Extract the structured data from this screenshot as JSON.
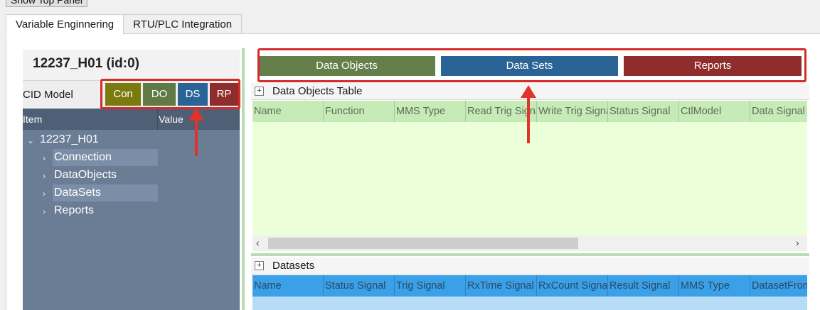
{
  "top_panel_button": "Show Top Panel",
  "tabs": [
    {
      "label": "Variable Enginnering",
      "active": true
    },
    {
      "label": "RTU/PLC Integration",
      "active": false
    }
  ],
  "left_panel": {
    "title": "12237_H01 (id:0)",
    "cid_label": "CID Model",
    "model_buttons": [
      {
        "label": "Con",
        "color": "#7a7a0e"
      },
      {
        "label": "DO",
        "color": "#5f7a45"
      },
      {
        "label": "DS",
        "color": "#2a6496"
      },
      {
        "label": "RP",
        "color": "#8f2d2d"
      }
    ],
    "tree_headers": {
      "item": "Item",
      "value": "Value"
    },
    "tree": {
      "root": "12237_H01",
      "children": [
        "Connection",
        "DataObjects",
        "DataSets",
        "Reports"
      ]
    }
  },
  "main_buttons": [
    {
      "label": "Data Objects",
      "color": "#647f4a"
    },
    {
      "label": "Data Sets",
      "color": "#2a6496"
    },
    {
      "label": "Reports",
      "color": "#8f2d2d"
    }
  ],
  "data_objects_table": {
    "title": "Data Objects Table",
    "columns": [
      "Name",
      "Function",
      "MMS Type",
      "Read Trig Signal",
      "Write Trig Signal",
      "Status Signal",
      "CtlModel",
      "Data Signal"
    ]
  },
  "datasets_table": {
    "title": "Datasets",
    "columns": [
      "Name",
      "Status Signal",
      "Trig Signal",
      "RxTime Signal",
      "RxCount Signal",
      "Result Signal",
      "MMS Type",
      "DatasetFrom"
    ]
  },
  "accent_colors": {
    "highlight_box": "#d62b2b",
    "tree_bg": "#6b7d95",
    "green_grid": "#ebffd9",
    "blue_grid": "#3aa0e8"
  }
}
